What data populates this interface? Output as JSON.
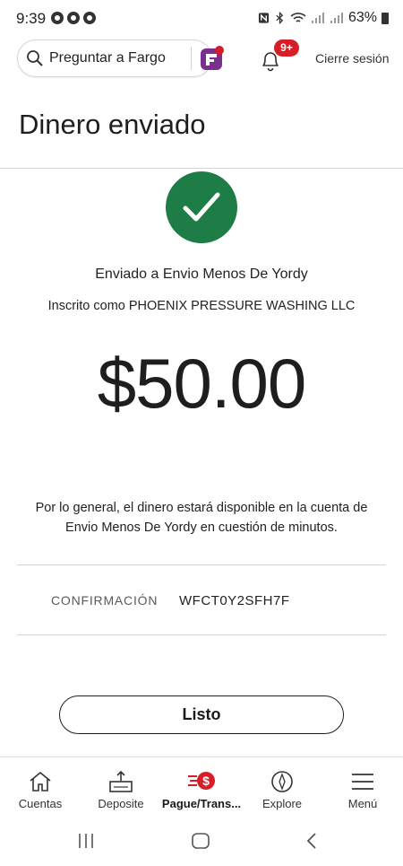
{
  "status_bar": {
    "time": "9:39",
    "battery": "63%"
  },
  "header": {
    "search_placeholder": "Preguntar a Fargo",
    "notification_badge": "9+",
    "signout_label": "Cierre sesión"
  },
  "page": {
    "title": "Dinero enviado"
  },
  "success": {
    "sent_to": "Enviado a Envio Menos De Yordy",
    "enrolled_as": "Inscrito como PHOENIX PRESSURE WASHING LLC",
    "amount": "$50.00",
    "note": "Por lo general, el dinero estará disponible en la cuenta de Envio Menos De Yordy en cuestión de minutos."
  },
  "confirmation": {
    "label": "CONFIRMACIÓN",
    "value": "WFCT0Y2SFH7F"
  },
  "actions": {
    "done_label": "Listo"
  },
  "bottom_nav": {
    "items": [
      {
        "label": "Cuentas",
        "icon": "house-icon"
      },
      {
        "label": "Deposite",
        "icon": "deposit-icon"
      },
      {
        "label": "Pague/Trans...",
        "icon": "pay-transfer-icon"
      },
      {
        "label": "Explore",
        "icon": "compass-icon"
      },
      {
        "label": "Menú",
        "icon": "menu-icon"
      }
    ],
    "active_index": 2
  },
  "colors": {
    "success_green": "#1e7d46",
    "brand_red": "#d71e28",
    "fargo_purple": "#7b2f8e"
  }
}
